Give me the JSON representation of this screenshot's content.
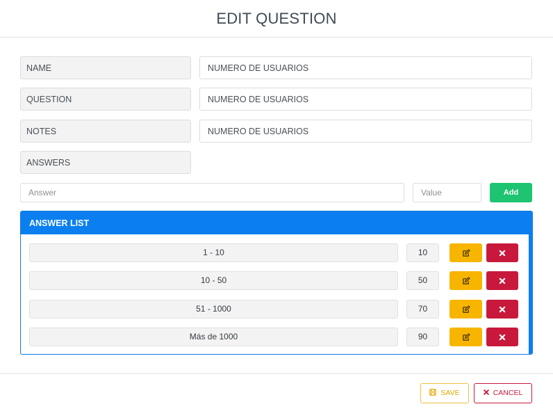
{
  "modal": {
    "title": "EDIT QUESTION"
  },
  "fields": [
    {
      "label": "NAME",
      "value": "NUMERO DE USUARIOS"
    },
    {
      "label": "QUESTION",
      "value": "NUMERO DE USUARIOS"
    },
    {
      "label": "NOTES",
      "value": "NUMERO DE USUARIOS"
    }
  ],
  "answers_label": "ANSWERS",
  "new_answer": {
    "answer_placeholder": "Answer",
    "value_placeholder": "Value",
    "add_label": "Add"
  },
  "answer_list": {
    "title": "ANSWER LIST",
    "items": [
      {
        "answer": "1 - 10",
        "value": "10"
      },
      {
        "answer": "10 - 50",
        "value": "50"
      },
      {
        "answer": "51 - 1000",
        "value": "70"
      },
      {
        "answer": "Más de 1000",
        "value": "90"
      }
    ]
  },
  "footer": {
    "save_label": "SAVE",
    "cancel_label": "CANCEL"
  },
  "colors": {
    "accent": "#0b7ff0",
    "add": "#1ec471",
    "edit": "#f7b500",
    "delete": "#c8193d",
    "save": "#e0a800"
  },
  "icons": {
    "edit": "edit-icon",
    "delete": "close-icon",
    "save": "floppy-disk-icon",
    "cancel": "close-icon"
  }
}
